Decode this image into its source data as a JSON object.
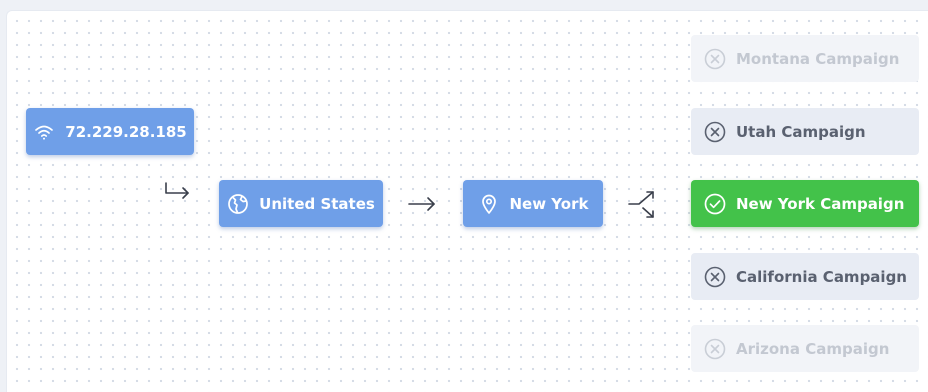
{
  "source": {
    "ip": "72.229.28.185",
    "icon": "wifi-icon"
  },
  "country": {
    "label": "United States",
    "icon": "globe-icon"
  },
  "region": {
    "label": "New York",
    "icon": "location-pin-icon"
  },
  "campaigns": [
    {
      "label": "Montana Campaign",
      "status": "rejected",
      "icon": "x-circle-icon"
    },
    {
      "label": "Utah Campaign",
      "status": "rejected",
      "icon": "x-circle-icon"
    },
    {
      "label": "New York Campaign",
      "status": "selected",
      "icon": "check-circle-icon"
    },
    {
      "label": "California Campaign",
      "status": "rejected",
      "icon": "x-circle-icon"
    },
    {
      "label": "Arizona Campaign",
      "status": "rejected",
      "icon": "x-circle-icon"
    }
  ],
  "colors": {
    "node_blue": "#6f9fe8",
    "selected_green": "#43c24a",
    "rejected_grey": "#e8ecf4",
    "faded": "#f2f4f8"
  }
}
